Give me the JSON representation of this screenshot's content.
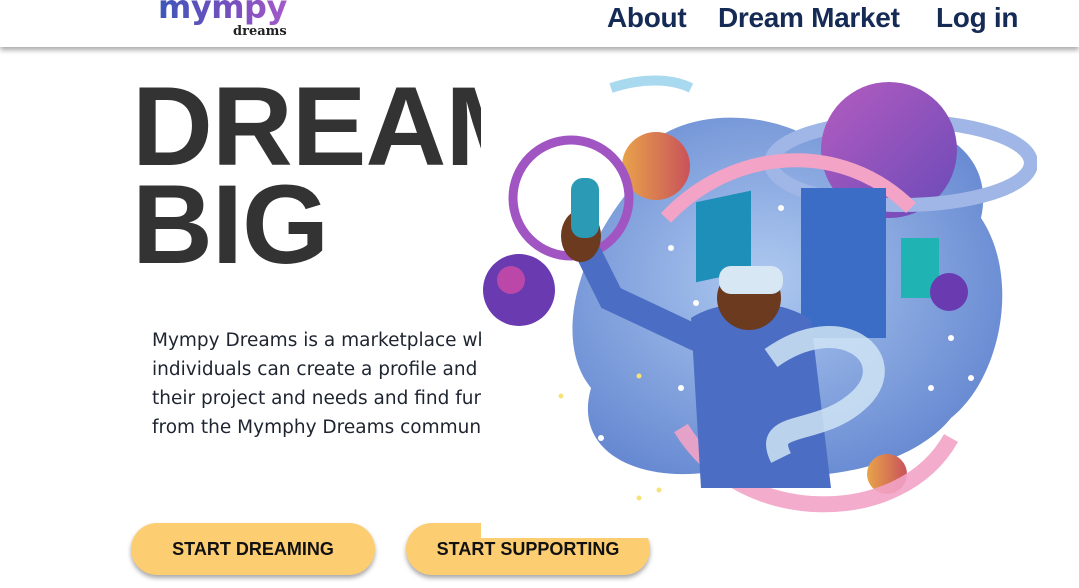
{
  "header": {
    "logo": {
      "word": "mympy",
      "sub": "dreams"
    },
    "nav": [
      {
        "label": "About"
      },
      {
        "label": "Dream Market"
      },
      {
        "label": "Log in"
      }
    ]
  },
  "hero": {
    "title_line1": "DREAM",
    "title_line2": "BIG",
    "description": "Mympy Dreams is a marketplace where individuals can create a profile and post their project and needs and find funding from the Mymphy Dreams community.",
    "buttons": {
      "start_dreaming": "START DREAMING",
      "start_supporting": "START SUPPORTING"
    }
  },
  "colors": {
    "nav_text": "#152a55",
    "title_text": "#333333",
    "button_bg": "#fdcd72",
    "logo_gradient": [
      "#3d56b8",
      "#a55bc9"
    ]
  }
}
